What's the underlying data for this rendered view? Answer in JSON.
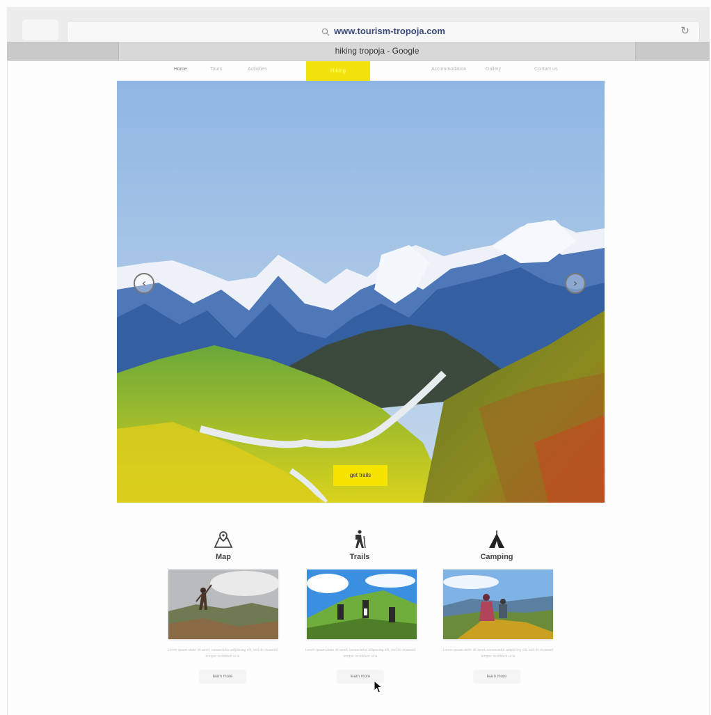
{
  "browser": {
    "url": "www.tourism-tropoja.com",
    "tab_title": "hiking tropoja - Google"
  },
  "nav": {
    "items": [
      "Home",
      "Tours",
      "Activities",
      "Hiking",
      "Accommodation",
      "Gallery",
      "Contact us"
    ],
    "active": "Hiking"
  },
  "hero": {
    "button_label": "get trails"
  },
  "features": [
    {
      "title": "Map",
      "icon": "map-icon",
      "description": "Lorem ipsum dolor sit amet, consectetur adipiscing elit, sed do eiusmod tempor incididunt ut la",
      "button_label": "learn more"
    },
    {
      "title": "Trails",
      "icon": "hiker-icon",
      "description": "Lorem ipsum dolor sit amet, consectetur adipiscing elit, sed do eiusmod tempor incididunt ut la",
      "button_label": "learn more"
    },
    {
      "title": "Camping",
      "icon": "tent-icon",
      "description": "Lorem ipsum dolor sit amet, consectetur adipiscing elit, sed do eiusmod tempor incididunt ut la",
      "button_label": "learn more"
    }
  ],
  "colors": {
    "accent": "#f2e30d"
  }
}
